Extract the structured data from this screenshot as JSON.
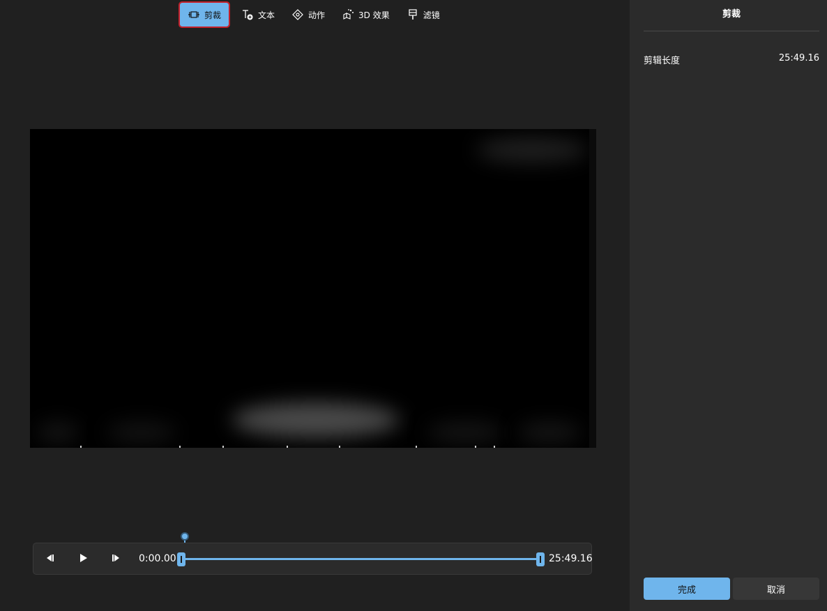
{
  "toolbar": {
    "tools": [
      {
        "label": "剪裁",
        "icon": "trim-icon",
        "active": true
      },
      {
        "label": "文本",
        "icon": "text-icon",
        "active": false
      },
      {
        "label": "动作",
        "icon": "motion-icon",
        "active": false
      },
      {
        "label": "3D 效果",
        "icon": "3d-effects-icon",
        "active": false
      },
      {
        "label": "滤镜",
        "icon": "filter-icon",
        "active": false
      }
    ]
  },
  "player": {
    "start_time": "0:00.00",
    "end_time": "25:49.16",
    "playhead_position": 0,
    "trim_start": 0,
    "trim_end": 1
  },
  "panel": {
    "title": "剪裁",
    "clip_length_label": "剪辑长度",
    "clip_length_value": "25:49.16",
    "done_label": "完成",
    "cancel_label": "取消"
  },
  "colors": {
    "accent": "#6fb5ec",
    "active_outline": "#c4202a",
    "background": "#202020",
    "panel_background": "#2b2b2b"
  }
}
